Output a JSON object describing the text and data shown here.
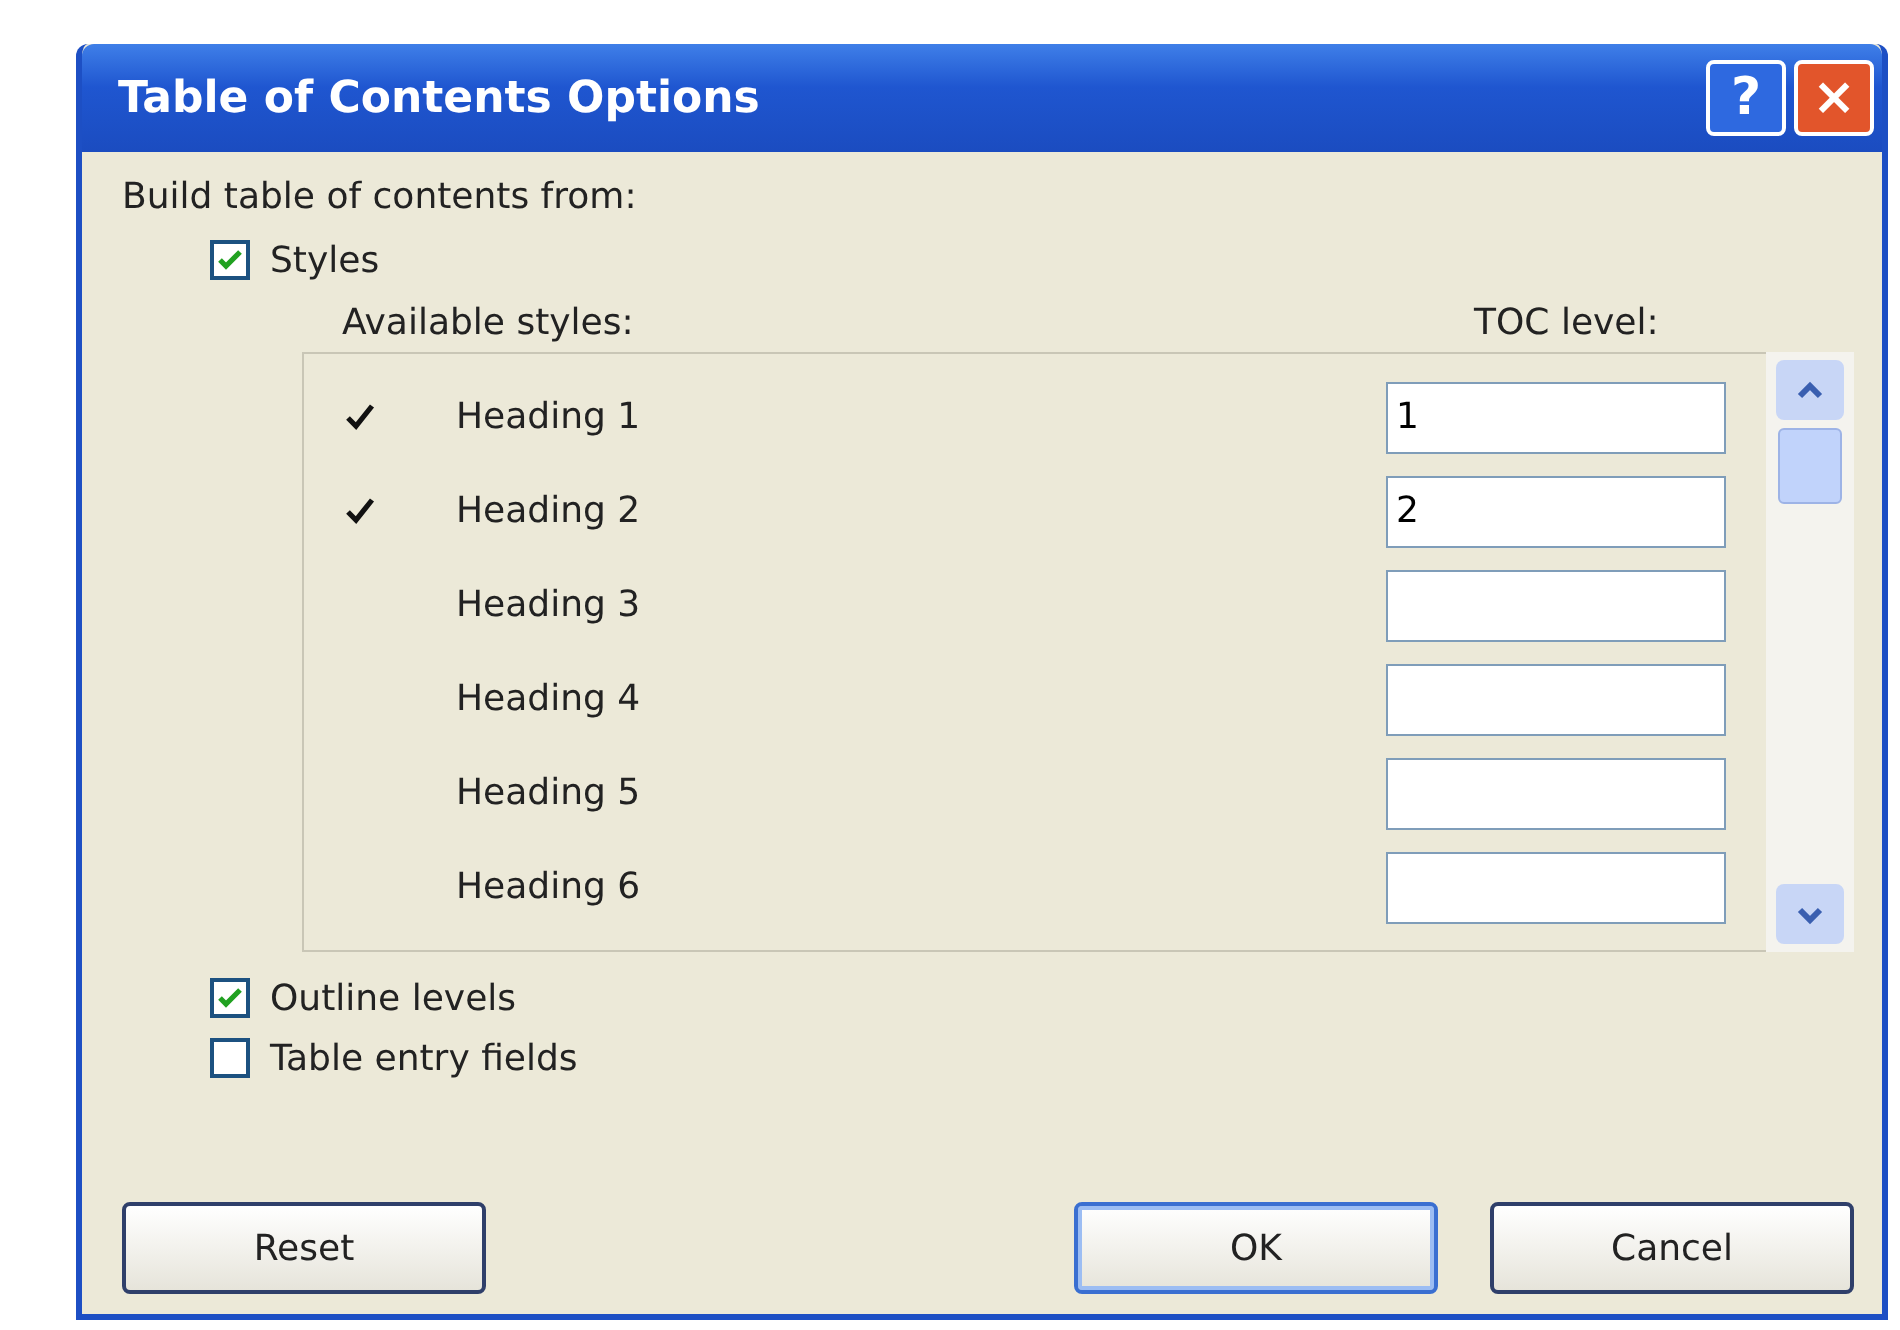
{
  "window": {
    "title": "Table of Contents Options",
    "help_button": "?",
    "close_button": "×"
  },
  "build_label": "Build table of contents from:",
  "options": [
    {
      "label": "Styles",
      "checked": true
    }
  ],
  "styles_list": {
    "column_1": "Available styles:",
    "column_2": "TOC level:",
    "rows": [
      {
        "style": "Heading 1",
        "used": true,
        "level": "1"
      },
      {
        "style": "Heading 2",
        "used": true,
        "level": "2"
      },
      {
        "style": "Heading 3",
        "used": false
      },
      {
        "style": "Heading 4",
        "used": false
      },
      {
        "style": "Heading 5",
        "used": false
      },
      {
        "style": "Heading 6",
        "used": false
      }
    ]
  },
  "more_options": [
    {
      "label": "Outline levels",
      "checked": true
    },
    {
      "label": "Table entry fields",
      "checked": false
    }
  ],
  "buttons": [
    {
      "label": "Reset",
      "kind": "left"
    },
    {
      "label": "OK",
      "kind": "right",
      "default": true
    },
    {
      "label": "Cancel",
      "kind": "right",
      "default": false
    }
  ]
}
